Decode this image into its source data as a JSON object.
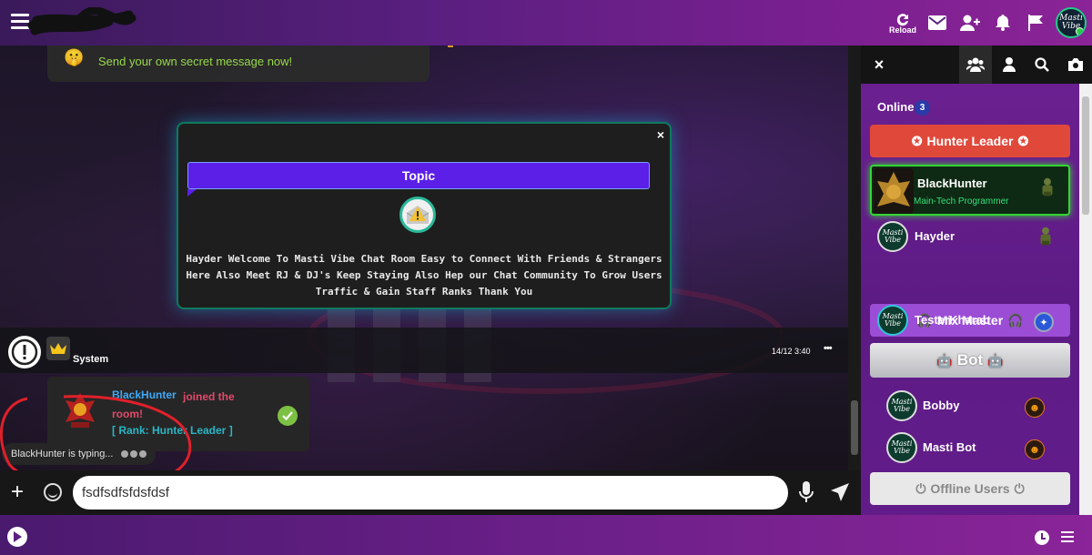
{
  "topbar": {
    "reload_label": "Reload",
    "avatar_text": "Masti Vibe"
  },
  "chat": {
    "secret_message": "Send your own secret message now!",
    "topic": {
      "title": "Topic",
      "text": "Hayder Welcome To Masti Vibe Chat Room Easy to Connect With Friends & Strangers Here Also Meet RJ & DJ's Keep Staying Also Hep our Chat Community To Grow Users Traffic & Gain Staff Ranks Thank You",
      "close": "×"
    },
    "system": {
      "name": "System",
      "time": "14/12 3:40",
      "more": "•••"
    },
    "join": {
      "user": "BlackHunter",
      "text": "joined the room!",
      "rank": "[ Rank: Hunter Leader ]"
    },
    "typing": "BlackHunter  is typing..."
  },
  "input": {
    "value": "fsdfsdfsfdsfdsf",
    "placeholder": ""
  },
  "panel": {
    "close": "×",
    "online_label": "Online",
    "online_count": "3",
    "groups": {
      "hunter": "Hunter Leader",
      "mix": "Mix Master",
      "bot": "Bot",
      "offline": "Offline Users"
    },
    "users": [
      {
        "name": "BlackHunter",
        "mood": "Main-Tech Programmer"
      },
      {
        "name": "Hayder",
        "mood": ""
      },
      {
        "name": "TesterKharab",
        "mood": ""
      },
      {
        "name": "Bobby",
        "mood": ""
      },
      {
        "name": "Masti Bot",
        "mood": ""
      }
    ]
  },
  "colors": {
    "accent": "#5b1fe8",
    "hunter": "#e0493a",
    "mix": "#9b4dd6",
    "online": "#35d335"
  }
}
